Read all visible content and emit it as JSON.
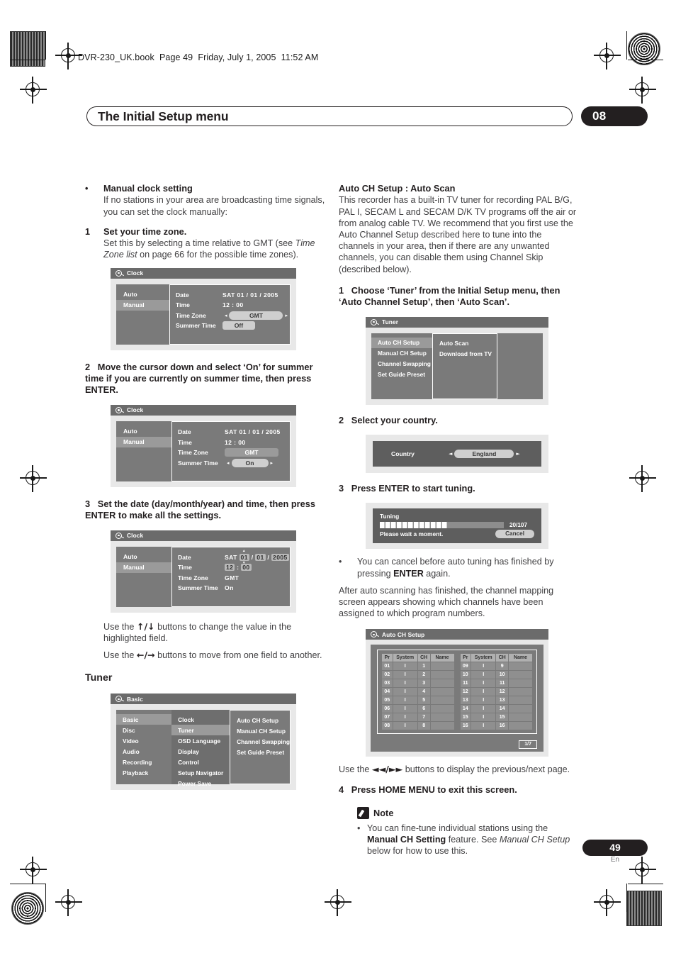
{
  "page": {
    "book_line": "DVR-230_UK.book  Page 49  Friday, July 1, 2005  11:52 AM",
    "header_title": "The Initial Setup menu",
    "chapter_number": "08",
    "page_number": "49",
    "language_code": "En"
  },
  "left_column": {
    "bullet_manual_clock": {
      "bullet": "•",
      "heading": "Manual clock setting",
      "text": "If no stations in your area are broadcasting time signals, you can set the clock manually:"
    },
    "step1": {
      "number": "1",
      "heading": "Set your time zone.",
      "text_a": "Set this by selecting a time relative to GMT (see ",
      "text_italic": "Time Zone list",
      "text_b": " on page 66 for the possible time zones)."
    },
    "step2": {
      "number": "2",
      "heading": "Move the cursor down and select ‘On’ for summer time if you are currently on summer time, then press ENTER."
    },
    "step3": {
      "number": "3",
      "heading": "Set the date (day/month/year) and time, then press ENTER to make all the settings."
    },
    "use_updown": {
      "prefix": "Use the ",
      "keys": "↑/↓",
      "suffix": " buttons to change the value in the highlighted field."
    },
    "use_leftright": {
      "prefix": "Use the ",
      "keys": "←/→",
      "suffix": " buttons to move from one field to another."
    },
    "tuner_heading": "Tuner"
  },
  "right_column": {
    "section_heading": "Auto CH Setup : Auto Scan",
    "intro": "This recorder has a built-in TV tuner for recording PAL B/G, PAL I, SECAM L and SECAM D/K TV programs off the air or from analog cable TV. We recommend that you first use the Auto Channel Setup described here to tune into the channels in your area, then if there are any unwanted channels, you can disable them using Channel Skip (described below).",
    "step1": {
      "number": "1",
      "heading": "Choose ‘Tuner’ from the Initial Setup menu, then ‘Auto Channel Setup’, then ‘Auto Scan’."
    },
    "step2": {
      "number": "2",
      "heading": "Select your country."
    },
    "step3": {
      "number": "3",
      "heading": "Press ENTER to start tuning."
    },
    "cancel_bullet": {
      "bullet": "•",
      "text_a": "You can cancel before auto tuning has finished by pressing ",
      "bold": "ENTER",
      "text_b": " again."
    },
    "after_scan": "After auto scanning has finished, the channel mapping screen appears showing which channels have been assigned to which program numbers.",
    "use_skip": {
      "prefix": "Use the ",
      "keys": "◄◄/►►",
      "suffix": " buttons to display the previous/next page."
    },
    "step4": {
      "number": "4",
      "heading": "Press HOME MENU to exit this screen."
    },
    "note": {
      "title": "Note",
      "bullet": "•",
      "text_a": "You can fine-tune individual stations using the ",
      "bold": "Manual CH Setting",
      "text_b": " feature. See ",
      "italic": "Manual CH Setup",
      "text_c": " below for how to use this."
    }
  },
  "screenshots": {
    "clock1": {
      "title": "Clock",
      "left_items": [
        "Auto",
        "Manual"
      ],
      "selected_left": "Manual",
      "rows": [
        {
          "label": "Date",
          "value": "SAT  01  /  01  /  2005"
        },
        {
          "label": "Time",
          "value": "12  :  00"
        },
        {
          "label": "Time Zone",
          "value": "GMT"
        },
        {
          "label": "Summer Time",
          "value": "Off"
        }
      ]
    },
    "clock2": {
      "title": "Clock",
      "left_items": [
        "Auto",
        "Manual"
      ],
      "selected_left": "Manual",
      "rows": [
        {
          "label": "Date",
          "value": "SAT  01  /  01  /  2005"
        },
        {
          "label": "Time",
          "value": "12  :  00"
        },
        {
          "label": "Time Zone",
          "value": "GMT"
        },
        {
          "label": "Summer Time",
          "value": "On"
        }
      ]
    },
    "clock3": {
      "title": "Clock",
      "left_items": [
        "Auto",
        "Manual"
      ],
      "selected_left": "Manual",
      "date_prefix": "SAT",
      "date_day": "01",
      "date_month": "01",
      "date_year": "2005",
      "time_hour": "12",
      "time_min": "00",
      "rows": [
        {
          "label": "Date"
        },
        {
          "label": "Time"
        },
        {
          "label": "Time Zone",
          "value": "GMT"
        },
        {
          "label": "Summer Time",
          "value": "On"
        }
      ]
    },
    "basic_menu": {
      "title": "Basic",
      "col1": [
        "Basic",
        "Disc",
        "Video",
        "Audio",
        "Recording",
        "Playback"
      ],
      "col1_selected": "Basic",
      "col2": [
        "Clock",
        "Tuner",
        "OSD Language",
        "Display",
        "Control",
        "Setup Navigator",
        "Power Save"
      ],
      "col2_selected": "Tuner",
      "col3": [
        "Auto CH Setup",
        "Manual CH Setup",
        "Channel Swapping",
        "Set Guide Preset"
      ]
    },
    "tuner_menu": {
      "title": "Tuner",
      "col1": [
        "Auto CH Setup",
        "Manual CH Setup",
        "Channel Swapping",
        "Set Guide Preset"
      ],
      "col1_selected": "Auto CH Setup",
      "col2": [
        "Auto Scan",
        "Download from TV"
      ]
    },
    "country": {
      "label": "Country",
      "value": "England",
      "arrow_left": "◄",
      "arrow_right": "►"
    },
    "tuning": {
      "title": "Tuning",
      "progress_text": "20/107",
      "progress_percent": 55,
      "wait_text": "Please wait a moment.",
      "cancel_label": "Cancel"
    },
    "auto_ch_setup": {
      "title": "Auto CH Setup",
      "headers": [
        "Pr",
        "System",
        "CH",
        "Name"
      ],
      "left_rows": [
        [
          "01",
          "I",
          "1",
          ""
        ],
        [
          "02",
          "I",
          "2",
          ""
        ],
        [
          "03",
          "I",
          "3",
          ""
        ],
        [
          "04",
          "I",
          "4",
          ""
        ],
        [
          "05",
          "I",
          "5",
          ""
        ],
        [
          "06",
          "I",
          "6",
          ""
        ],
        [
          "07",
          "I",
          "7",
          ""
        ],
        [
          "08",
          "I",
          "8",
          ""
        ]
      ],
      "right_rows": [
        [
          "09",
          "I",
          "9",
          ""
        ],
        [
          "10",
          "I",
          "10",
          ""
        ],
        [
          "11",
          "I",
          "11",
          ""
        ],
        [
          "12",
          "I",
          "12",
          ""
        ],
        [
          "13",
          "I",
          "13",
          ""
        ],
        [
          "14",
          "I",
          "14",
          ""
        ],
        [
          "15",
          "I",
          "15",
          ""
        ],
        [
          "16",
          "I",
          "16",
          ""
        ]
      ],
      "page_indicator": "1/7"
    }
  }
}
